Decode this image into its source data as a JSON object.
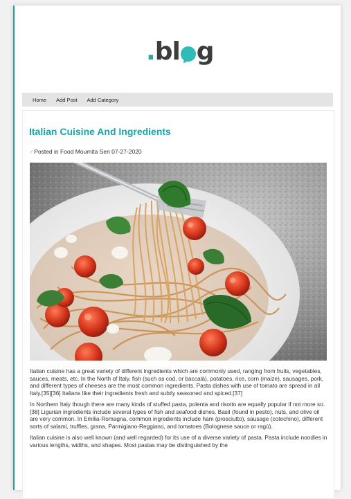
{
  "header": {
    "logo_text": "blog",
    "logo_dot": "."
  },
  "nav": {
    "items": [
      "Home",
      "Add Post",
      "Add Category"
    ]
  },
  "post": {
    "title": "Italian Cuisine And Ingredients",
    "meta": "- Posted in Food Moumita Sen 07-27-2020",
    "image_alt": "Plate of spaghetti with cherry tomatoes and basil twirled on a fork",
    "paragraphs": [
      "Italian cuisine has a great variety of different ingredients which are commonly used, ranging from fruits, vegetables, sauces, meats, etc. In the North of Italy, fish (such as cod, or baccalà), potatoes, rice, corn (maize), sausages, pork, and different types of cheeses are the most common ingredients. Pasta dishes with use of tomato are spread in all Italy.[35][36] Italians like their ingredients fresh and subtly seasoned and spiced.[37]",
      "In Northern Italy though there are many kinds of stuffed pasta, polenta and risotto are equally popular if not more so.[38] Ligurian ingredients include several types of fish and seafood dishes. Basil (found in pesto), nuts, and olive oil are very common. In Emilia-Romagna, common ingredients include ham (prosciutto), sausage (cotechino), different sorts of salami, truffles, grana, Parmigiano-Reggiano, and tomatoes (Bolognese sauce or ragù).",
      "Italian cuisine is also well known (and well regarded) for its use of a diverse variety of pasta. Pasta include noodles in various lengths, widths, and shapes. Most pastas may be distinguished by the"
    ]
  },
  "colors": {
    "accent": "#1da4a8",
    "nav_bg": "#e4e4e4"
  }
}
